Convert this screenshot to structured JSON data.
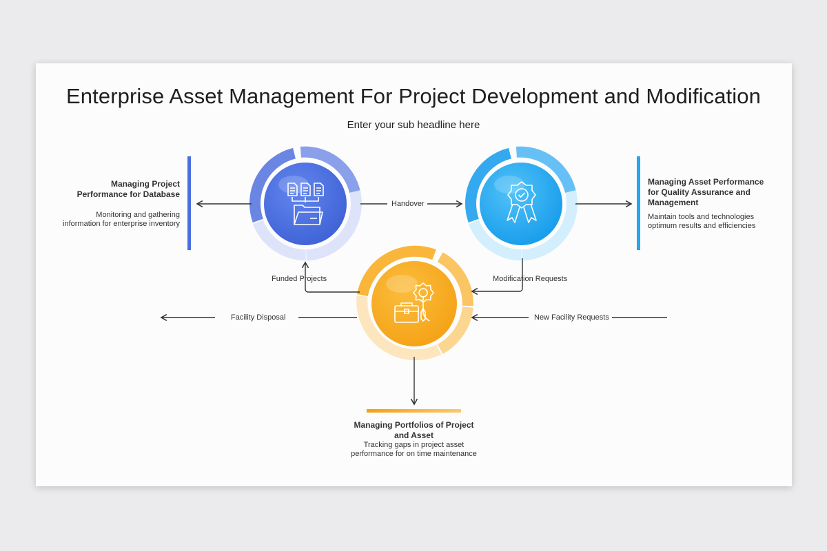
{
  "title": "Enterprise Asset Management For Project Development and Modification",
  "subtitle": "Enter your sub headline here",
  "nodes": {
    "database": {
      "icon": "folder-documents-icon",
      "color": "#4a6fe0"
    },
    "quality": {
      "icon": "award-badge-icon",
      "color": "#23a7ef"
    },
    "portfolio": {
      "icon": "briefcase-gear-icon",
      "color": "#f7aa1b"
    }
  },
  "arrows": {
    "handover": "Handover",
    "funded": "Funded Projects",
    "modification": "Modification Requests",
    "disposal": "Facility Disposal",
    "new_requests": "New Facility Requests"
  },
  "blocks": {
    "left": {
      "title": "Managing Project Performance for Database",
      "desc": "Monitoring and gathering information for enterprise inventory",
      "accent": "#4a6fe0"
    },
    "right": {
      "title": "Managing Asset Performance for Quality Assurance and Management",
      "desc": "Maintain tools and technologies optimum results and efficiencies",
      "accent": "#23a7ef"
    },
    "bottom": {
      "title": "Managing Portfolios of Project and Asset",
      "desc": "Tracking gaps in project asset performance for on time maintenance",
      "accent": "#f7aa1b"
    }
  }
}
